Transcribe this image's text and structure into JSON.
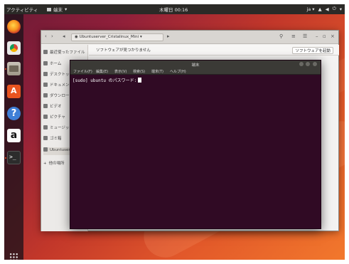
{
  "topbar": {
    "activities": "アクティビティ",
    "app_menu": "端末",
    "clock": "木曜日 00:16"
  },
  "dock": {
    "items": [
      "firefox-icon",
      "chromium-icon",
      "files-icon",
      "software-icon",
      "help-icon",
      "amazon-icon",
      "terminal-icon",
      "show-apps-icon"
    ]
  },
  "files": {
    "path": "Ubuntuserver_Cristalinux_Mini",
    "infobar_text": "ソフトウェアが見つかりません",
    "infobar_button": "ソフトウェアを起動",
    "sidebar": [
      "最近使ったファイル",
      "ホーム",
      "デスクトップ",
      "ドキュメント",
      "ダウンロード",
      "ビデオ",
      "ピクチャ",
      "ミュージック",
      "ゴミ箱",
      "Ubuntuserver",
      "他の場所"
    ]
  },
  "terminal": {
    "title": "端末",
    "menu": [
      "ファイル(F)",
      "編集(E)",
      "表示(V)",
      "検索(S)",
      "端末(T)",
      "ヘルプ(H)"
    ],
    "prompt": "[sudo] ubuntu のパスワード:"
  },
  "colors": {
    "ubuntu_orange": "#e95420",
    "terminal_bg": "#300a24",
    "topbar_bg": "#2b2a27"
  }
}
